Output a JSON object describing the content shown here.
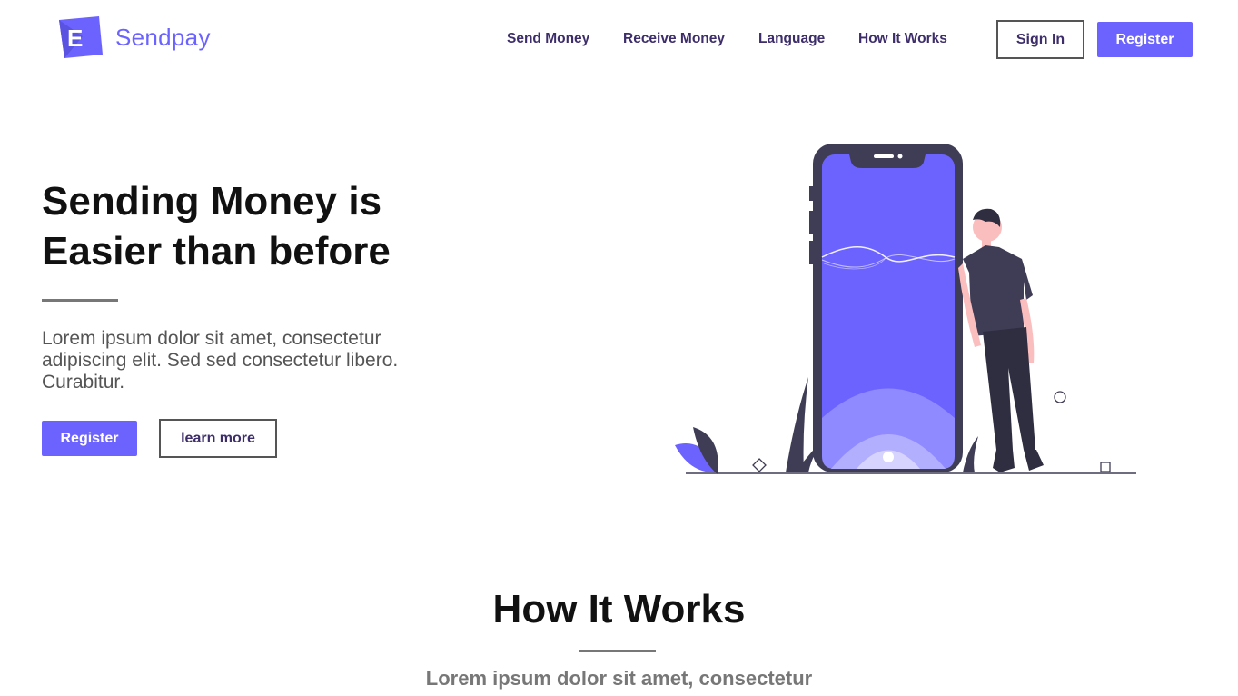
{
  "brand": {
    "name": "Sendpay",
    "logo_letter": "E",
    "accent_color": "#6c63ff",
    "text_color": "#3d2e6b"
  },
  "nav": {
    "links": [
      {
        "label": "Send Money"
      },
      {
        "label": "Receive Money"
      },
      {
        "label": "Language"
      },
      {
        "label": "How It Works"
      }
    ],
    "sign_in_label": "Sign In",
    "register_label": "Register"
  },
  "hero": {
    "title_line1": "Sending Money is",
    "title_line2": "Easier than before",
    "description": "Lorem ipsum dolor sit amet, consectetur adipiscing elit. Sed sed consectetur libero. Curabitur.",
    "register_label": "Register",
    "learn_more_label": "learn more"
  },
  "how_it_works": {
    "title": "How It Works",
    "subtitle": "Lorem ipsum dolor sit amet, consectetur"
  }
}
